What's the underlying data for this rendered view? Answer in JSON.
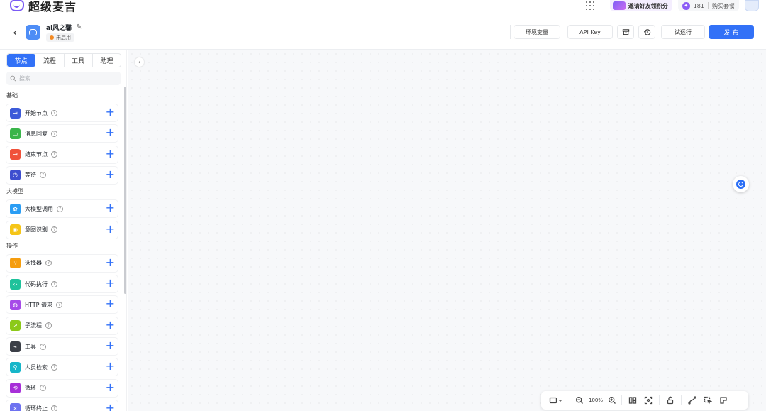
{
  "app": {
    "logo_text": "超级麦吉",
    "invite_label": "邀请好友领积分",
    "credits_count": "181",
    "buy_label": "购买套餐"
  },
  "header": {
    "flow_name": "ai风之馨",
    "status": "未启用",
    "env_label": "环境变量",
    "apikey_label": "API Key",
    "test_run_label": "试运行",
    "publish_label": "发 布"
  },
  "sidebar": {
    "tabs": [
      {
        "label": "节点",
        "active": true
      },
      {
        "label": "流程",
        "active": false
      },
      {
        "label": "工具",
        "active": false
      },
      {
        "label": "助理",
        "active": false
      }
    ],
    "search_placeholder": "搜索",
    "sections": [
      {
        "title": "基础",
        "items": [
          {
            "label": "开始节点",
            "icon": "start-icon",
            "color": "#3d5bd9"
          },
          {
            "label": "消息回复",
            "icon": "message-icon",
            "color": "#39b54a"
          },
          {
            "label": "结束节点",
            "icon": "end-icon",
            "color": "#f0523a"
          },
          {
            "label": "等待",
            "icon": "clock-icon",
            "color": "#3d4ecf"
          }
        ]
      },
      {
        "title": "大模型",
        "items": [
          {
            "label": "大模型调用",
            "icon": "model-icon",
            "color": "#2a9df4"
          },
          {
            "label": "意图识别",
            "icon": "intent-icon",
            "color": "#f5c518"
          }
        ]
      },
      {
        "title": "操作",
        "items": [
          {
            "label": "选择器",
            "icon": "branch-icon",
            "color": "#f59d0e"
          },
          {
            "label": "代码执行",
            "icon": "code-icon",
            "color": "#1ec29b"
          },
          {
            "label": "HTTP 请求",
            "icon": "globe-icon",
            "color": "#a64be8"
          },
          {
            "label": "子流程",
            "icon": "subflow-icon",
            "color": "#8cc919"
          },
          {
            "label": "工具",
            "icon": "tool-icon",
            "color": "#3b3f47"
          },
          {
            "label": "人员检索",
            "icon": "person-search-icon",
            "color": "#16b6c9"
          },
          {
            "label": "循环",
            "icon": "loop-icon",
            "color": "#a72fd8"
          },
          {
            "label": "循环终止",
            "icon": "loop-stop-icon",
            "color": "#6e72f0"
          }
        ]
      }
    ]
  },
  "toolbar": {
    "zoom": "100%"
  }
}
